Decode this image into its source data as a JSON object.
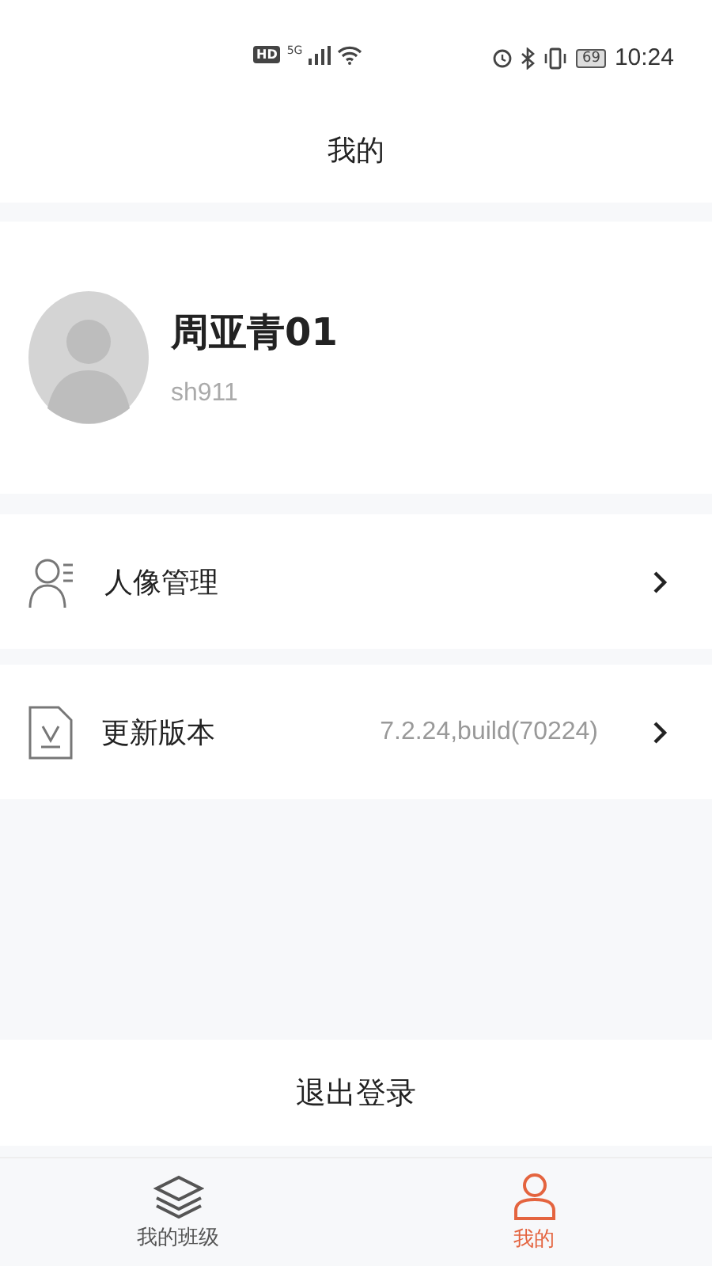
{
  "status_bar": {
    "network_badge": "HD",
    "network_type": "5G",
    "battery": "69",
    "time": "10:24"
  },
  "header": {
    "title": "我的"
  },
  "profile": {
    "name": "周亚青01",
    "account": "sh911"
  },
  "menu": [
    {
      "kind": "portrait",
      "label": "人像管理"
    },
    {
      "kind": "update",
      "label": "更新版本",
      "value": "7.2.24,build(70224)"
    }
  ],
  "logout": "退出登录",
  "tabs": [
    {
      "kind": "classes",
      "label": "我的班级",
      "selected": false
    },
    {
      "kind": "me",
      "label": "我的",
      "selected": true
    }
  ]
}
